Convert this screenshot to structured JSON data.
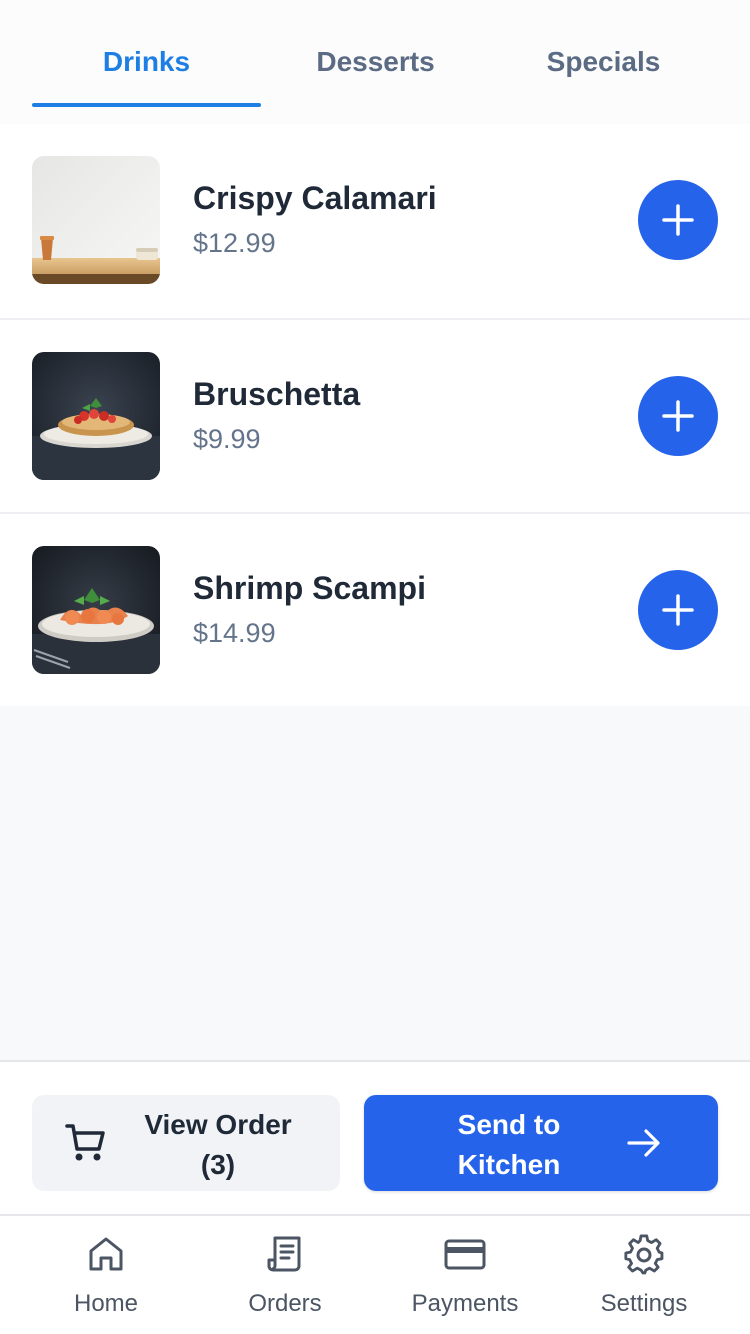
{
  "tabs": [
    {
      "label": "Drinks",
      "active": true
    },
    {
      "label": "Desserts",
      "active": false
    },
    {
      "label": "Specials",
      "active": false
    }
  ],
  "menu_items": [
    {
      "name": "Crispy Calamari",
      "price": "$12.99",
      "image": "calamari-photo"
    },
    {
      "name": "Bruschetta",
      "price": "$9.99",
      "image": "bruschetta-photo"
    },
    {
      "name": "Shrimp Scampi",
      "price": "$14.99",
      "image": "shrimp-scampi-photo"
    }
  ],
  "actions": {
    "view_order_line1": "View Order",
    "view_order_line2": "(3)",
    "send_line1": "Send to",
    "send_line2": "Kitchen"
  },
  "bottom_nav": [
    {
      "label": "Home",
      "icon": "home-icon"
    },
    {
      "label": "Orders",
      "icon": "receipt-icon"
    },
    {
      "label": "Payments",
      "icon": "credit-card-icon"
    },
    {
      "label": "Settings",
      "icon": "gear-icon"
    }
  ],
  "colors": {
    "accent": "#2563eb",
    "tab_active": "#1d7fe3",
    "text_primary": "#1f2937",
    "text_secondary": "#64748b"
  }
}
